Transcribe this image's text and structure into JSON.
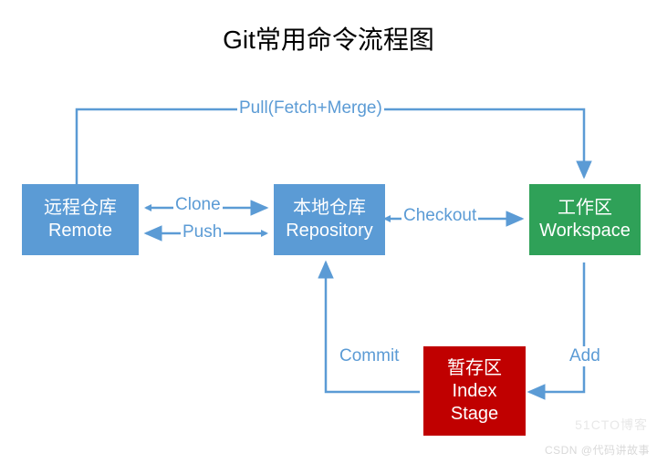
{
  "title": "Git常用命令流程图",
  "nodes": {
    "remote": {
      "line1": "远程仓库",
      "line2": "Remote"
    },
    "repo": {
      "line1": "本地仓库",
      "line2": "Repository"
    },
    "work": {
      "line1": "工作区",
      "line2": "Workspace"
    },
    "stage": {
      "line1": "暂存区",
      "line2": "Index",
      "line3": "Stage"
    }
  },
  "edges": {
    "pull": "Pull(Fetch+Merge)",
    "clone": "Clone",
    "push": "Push",
    "checkout": "Checkout",
    "commit": "Commit",
    "add": "Add"
  },
  "watermarks": {
    "w1": "CSDN @代码讲故事",
    "w2": "51CTO博客"
  }
}
